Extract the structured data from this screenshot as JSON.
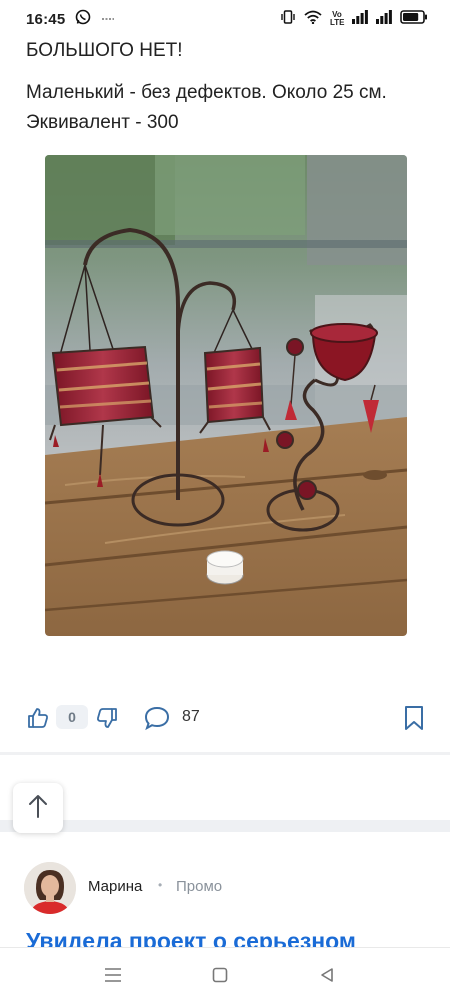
{
  "status_bar": {
    "time": "16:45",
    "icons": [
      "whatsapp-icon",
      "cast-icon",
      "vibrate-icon",
      "wifi-icon",
      "volte-icon",
      "signal-icon",
      "signal-icon",
      "battery-icon"
    ],
    "volte_label": "Vo\nLTE",
    "battery_level": 0.8
  },
  "post": {
    "line1": "БОЛЬШОГО НЕТ!",
    "line2": "Маленький - без дефектов. Около 25 см.",
    "line3": "Эквивалент - 300"
  },
  "actions": {
    "like_count": "0",
    "comment_count": "87",
    "icons": [
      "thumbs-up-icon",
      "thumbs-down-icon",
      "comment-icon",
      "bookmark-icon",
      "arrow-up-icon"
    ]
  },
  "promo": {
    "author": "Марина",
    "separator": "•",
    "label": "Промо",
    "title": "Увидела проект о серьезном"
  },
  "colors": {
    "accent_blue": "#1a6bd6",
    "badge_bg": "#eef1f5",
    "divider": "#eef0f3"
  },
  "nav": {
    "icons": [
      "menu-icon",
      "home-square-icon",
      "back-triangle-icon"
    ]
  }
}
